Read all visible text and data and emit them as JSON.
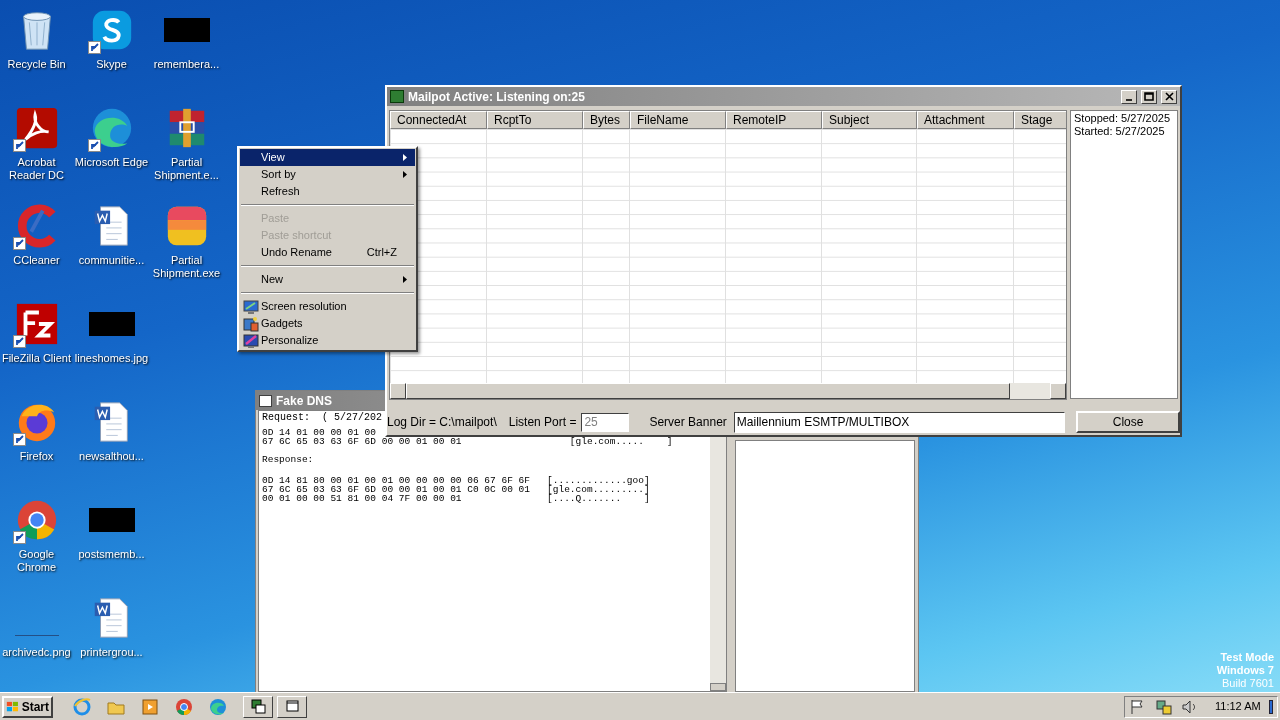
{
  "desktop_icons": [
    {
      "label": "Recycle Bin",
      "kind": "recycle",
      "shortcut": false
    },
    {
      "label": "Acrobat Reader DC",
      "kind": "pdf",
      "shortcut": true
    },
    {
      "label": "CCleaner",
      "kind": "cleaner",
      "shortcut": true
    },
    {
      "label": "FileZilla Client",
      "kind": "ftp",
      "shortcut": true
    },
    {
      "label": "Firefox",
      "kind": "firefox",
      "shortcut": true
    },
    {
      "label": "Google Chrome",
      "kind": "chrome",
      "shortcut": true
    },
    {
      "label": "archivedc.png",
      "kind": "blank",
      "shortcut": false
    },
    {
      "label": "Skype",
      "kind": "chat",
      "shortcut": true
    },
    {
      "label": "Microsoft Edge",
      "kind": "edge",
      "shortcut": true
    },
    {
      "label": "communitie...",
      "kind": "word",
      "shortcut": false
    },
    {
      "label": "lineshomes.jpg",
      "kind": "redacted",
      "shortcut": false
    },
    {
      "label": "newsalthou...",
      "kind": "word",
      "shortcut": false
    },
    {
      "label": "postsmemb...",
      "kind": "redacted",
      "shortcut": false
    },
    {
      "label": "printergrou...",
      "kind": "word",
      "shortcut": false
    },
    {
      "label": "remembera...",
      "kind": "redacted",
      "shortcut": false
    },
    {
      "label": "Partial Shipment.e...",
      "kind": "archive",
      "shortcut": false
    },
    {
      "label": "Partial Shipment.exe",
      "kind": "app",
      "shortcut": false
    }
  ],
  "context_menu": [
    {
      "kind": "item",
      "label": "View",
      "submenu": true,
      "selected": true,
      "disabled": false
    },
    {
      "kind": "item",
      "label": "Sort by",
      "submenu": true,
      "selected": false,
      "disabled": false
    },
    {
      "kind": "item",
      "label": "Refresh",
      "submenu": false,
      "selected": false,
      "disabled": false
    },
    {
      "kind": "separator"
    },
    {
      "kind": "item",
      "label": "Paste",
      "submenu": false,
      "selected": false,
      "disabled": true
    },
    {
      "kind": "item",
      "label": "Paste shortcut",
      "submenu": false,
      "selected": false,
      "disabled": true
    },
    {
      "kind": "item",
      "label": "Undo Rename",
      "shortcut": "Ctrl+Z",
      "submenu": false,
      "selected": false,
      "disabled": false
    },
    {
      "kind": "separator"
    },
    {
      "kind": "item",
      "label": "New",
      "submenu": true,
      "selected": false,
      "disabled": false
    },
    {
      "kind": "separator"
    },
    {
      "kind": "screen",
      "label": "Screen resolution",
      "submenu": false,
      "selected": false,
      "disabled": false
    },
    {
      "kind": "gadgets",
      "label": "Gadgets",
      "submenu": false,
      "selected": false,
      "disabled": false
    },
    {
      "kind": "personalize",
      "label": "Personalize",
      "submenu": false,
      "selected": false,
      "disabled": false
    }
  ],
  "fake_dns": {
    "title": "Fake DNS",
    "request_lines": [
      "Request:  ( 5/27/202",
      "0D 14 01 00 00 01 00",
      "67 6C 65 03 63 6F 6D 00 00 01 00 01                   [gle.com.....    ]"
    ],
    "response_label": "Response:",
    "response_lines": [
      "0D 14 81 80 00 01 00 01 00 00 00 00 06 67 6F 6F   [.............goo]",
      "67 6C 65 03 63 6F 6D 00 00 01 00 01 C0 0C 00 01   [gle.com.........]",
      "00 01 00 00 51 81 00 04 7F 00 00 01               [....Q.......    ]"
    ]
  },
  "mailpot": {
    "title": "Mailpot Active: Listening on:25",
    "columns": [
      "ConnectedAt",
      "RcptTo",
      "Bytes",
      "FileName",
      "RemoteIP",
      "Subject",
      "Attachment",
      "Stage"
    ],
    "status_lines": [
      "Stopped: 5/27/2025",
      "Started: 5/27/2025"
    ],
    "log_dir": "Log Dir = C:\\mailpot\\",
    "listen_port_label": "Listen Port =",
    "listen_port": "25",
    "banner_label": "Server Banner",
    "banner": "Maillennium ESMTP/MULTIBOX",
    "close_button": "Close"
  },
  "taskbar": {
    "start": "Start",
    "quick_launch": [
      {
        "kind": "ie"
      },
      {
        "kind": "folder"
      },
      {
        "kind": "media"
      },
      {
        "kind": "chrome"
      },
      {
        "kind": "edge"
      }
    ],
    "tasks": [
      {
        "kind": "mailpot",
        "selected": false
      },
      {
        "kind": "dns",
        "selected": false
      }
    ],
    "clock": "11:12 AM"
  },
  "watermark_os": [
    "Test Mode",
    "Windows 7",
    "Build 7601"
  ]
}
